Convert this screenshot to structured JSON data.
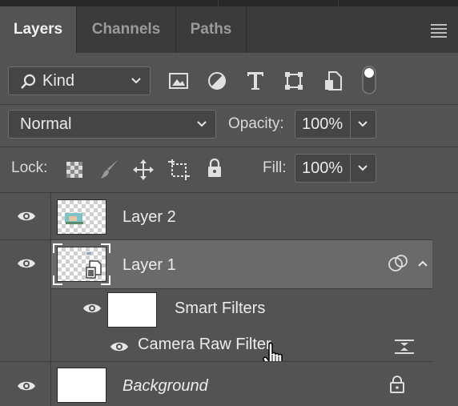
{
  "tabs": [
    {
      "label": "Layers",
      "active": true
    },
    {
      "label": "Channels",
      "active": false
    },
    {
      "label": "Paths",
      "active": false
    }
  ],
  "filter": {
    "kind_label": "Kind",
    "icons": [
      "image-filter-icon",
      "adjustment-filter-icon",
      "type-filter-icon",
      "shape-filter-icon",
      "smart-object-filter-icon",
      "filter-toggle-icon"
    ]
  },
  "blend": {
    "mode": "Normal",
    "opacity_label": "Opacity:",
    "opacity_value": "100%"
  },
  "lock": {
    "label": "Lock:",
    "fill_label": "Fill:",
    "fill_value": "100%",
    "icons": [
      "lock-transparent-pixels-icon",
      "lock-image-pixels-icon",
      "lock-position-icon",
      "lock-artboard-icon",
      "lock-all-icon"
    ]
  },
  "layers": [
    {
      "name": "Layer 2",
      "visible": true,
      "thumbnail": "transparent-with-image"
    },
    {
      "name": "Layer 1",
      "visible": true,
      "selected": true,
      "thumbnail": "smart-object",
      "expanded": true,
      "children": [
        {
          "name": "Smart Filters",
          "visible": true,
          "thumbnail": "white-mask"
        },
        {
          "name": "Camera Raw Filter",
          "visible": true
        }
      ]
    },
    {
      "name": "Background",
      "visible": true,
      "italic": true,
      "locked": true,
      "thumbnail": "white"
    }
  ],
  "colors": {
    "panel_bg": "#535353",
    "tab_bar_bg": "#3b3b3b",
    "selected_row": "#6a6a6a",
    "text": "#e6e6e6"
  }
}
